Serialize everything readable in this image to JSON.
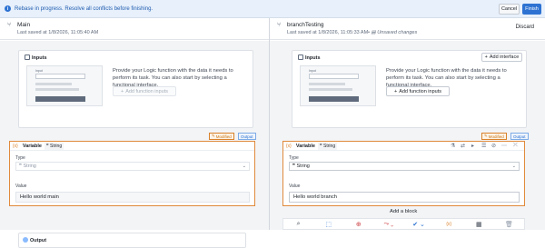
{
  "banner": {
    "message": "Rebase in progress. Resolve all conflicts before finishing.",
    "cancel_label": "Cancel",
    "finish_label": "Finish"
  },
  "left": {
    "name": "Main",
    "saved": "Last saved at 1/8/2026, 11:05:40 AM",
    "inputs": {
      "title": "Inputs",
      "description": "Provide your Logic function with the data it needs to perform its task. You can also start by selecting a functional interface.",
      "add_fn_label": "Add function inputs",
      "mock_label": "Input"
    },
    "tags": {
      "modified": "Modified",
      "output": "Output"
    },
    "variable": {
      "fx": "{x}",
      "title": "Variable",
      "type_badge": "String",
      "type_label": "Type",
      "type_value": "String",
      "value_label": "Value",
      "value": "Hello world main"
    },
    "output_title": "Output"
  },
  "right": {
    "name": "branchTesting",
    "saved": "Last saved at 1/8/2026, 11:05:33 AM",
    "unsaved": "Unsaved changes",
    "discard_label": "Discard",
    "inputs": {
      "title": "Inputs",
      "add_interface_label": "Add interface",
      "description": "Provide your Logic function with the data it needs to perform its task. You can also start by selecting a functional interface.",
      "add_fn_label": "Add function inputs",
      "mock_label": "Input"
    },
    "tags": {
      "modified": "Modified",
      "output": "Output"
    },
    "variable": {
      "fx": "{x}",
      "title": "Variable",
      "type_badge": "String",
      "type_label": "Type",
      "type_value": "String",
      "value_label": "Value",
      "value": "Hello world branch"
    },
    "add_block_label": "Add a block"
  },
  "colors": {
    "primary": "#2d72d2",
    "modified": "#d9822b",
    "banner_bg": "#e7f0fb"
  }
}
